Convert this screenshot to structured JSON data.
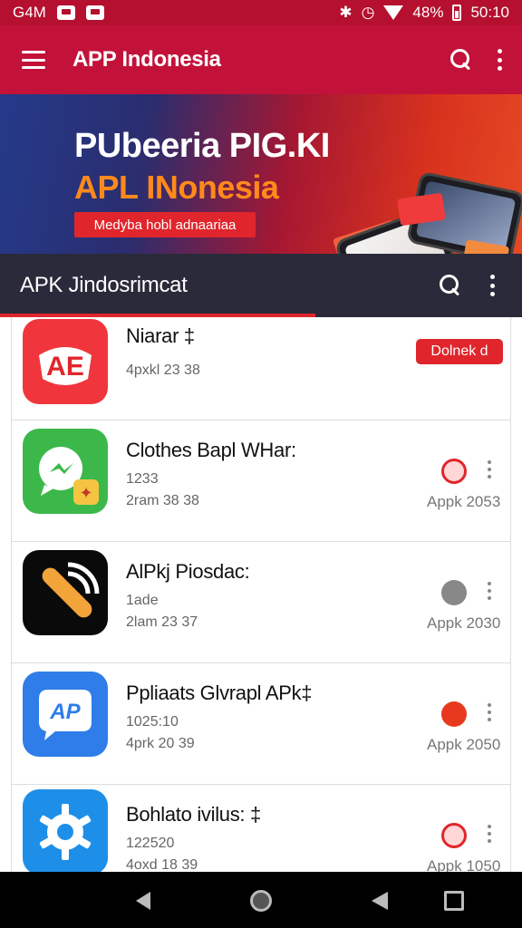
{
  "status_bar": {
    "carrier": "G4M",
    "battery": "48%",
    "time": "50:10",
    "icons": [
      "box-icon",
      "box-icon",
      "bluetooth-icon",
      "alarm-icon",
      "wifi-icon",
      "battery-icon"
    ]
  },
  "app_bar": {
    "title": "APP Indonesia",
    "icons": [
      "hamburger-menu-icon",
      "search-icon",
      "more-vert-icon"
    ]
  },
  "banner": {
    "title": "PUbeeria PIG.KI",
    "subtitle": "APL INonesia",
    "button_label": "Medyba hobl adnaariaa",
    "colors": {
      "title": "#ffffff",
      "subtitle": "#ff8a1c",
      "button": "#e0262c"
    }
  },
  "section": {
    "title": "APK Jindosrimcat",
    "icons": [
      "search-icon",
      "more-vert-icon"
    ]
  },
  "list": {
    "items": [
      {
        "name": "Niarar ‡",
        "meta1": "",
        "meta2": "4pxkl 23 38",
        "button_label": "Dolnek d",
        "icon": "app-icon-ap-red"
      },
      {
        "name": "Clothes Bapl WHar:",
        "meta1": "1233",
        "meta2": "2ram 38 38",
        "size": "Appk 2053",
        "icon": "app-icon-messenger-green",
        "status_icon": "red-status-icon"
      },
      {
        "name": "AlPkj Piosdac:",
        "meta1": "1ade",
        "meta2": "2lam 23 37",
        "size": "Appk 2030",
        "icon": "app-icon-signal-black",
        "status_icon": "gray-status-icon"
      },
      {
        "name": "Ppliaats Glvrapl APk‡",
        "meta1": "1025:10",
        "meta2": "4prk 20 39",
        "size": "Appk 2050",
        "icon": "app-icon-ap-blue",
        "status_icon": "red-status-icon"
      },
      {
        "name": "Bohlato ivilus: ‡",
        "meta1": "122520",
        "meta2": "4oxd 18 39",
        "size": "Appk 1050",
        "icon": "app-icon-gear-blue",
        "status_icon": "red-status-icon"
      }
    ]
  },
  "nav_bar": {
    "icons": [
      "back-icon",
      "home-icon",
      "back-icon",
      "recents-icon"
    ]
  }
}
